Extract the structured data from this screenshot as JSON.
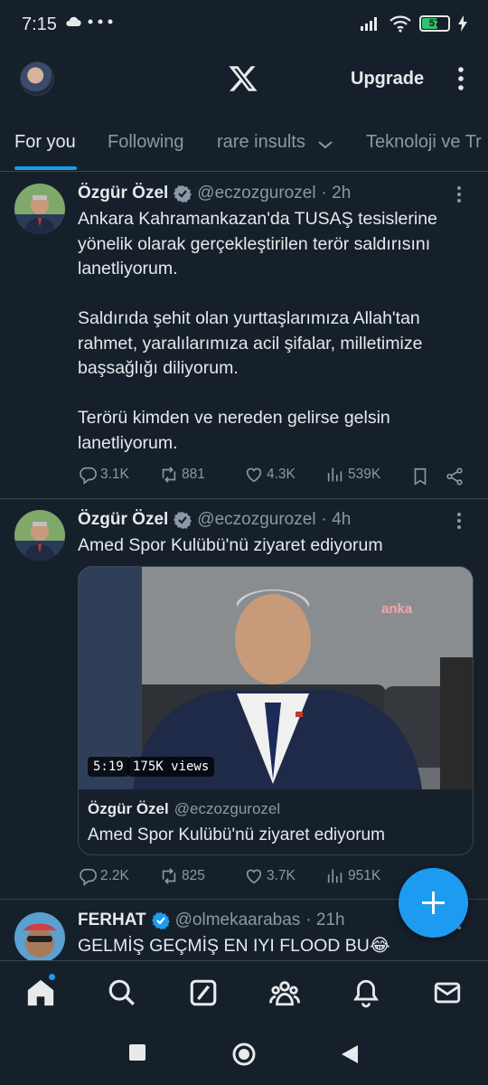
{
  "status_bar": {
    "time": "7:15",
    "battery": "57"
  },
  "top_bar": {
    "upgrade_label": "Upgrade"
  },
  "tabs": [
    {
      "label": "For you",
      "active": true
    },
    {
      "label": "Following"
    },
    {
      "label": "rare insults"
    },
    {
      "label": "Teknoloji ve Tr"
    }
  ],
  "tweets": [
    {
      "name": "Özgür Özel",
      "handle": "@eczozgurozel",
      "time": "· 2h",
      "paragraphs": [
        "Ankara Kahramankazan'da TUSAŞ tesislerine yönelik olarak gerçekleştirilen terör saldırısını lanetliyorum.",
        "Saldırıda şehit olan yurttaşlarımıza Allah'tan rahmet, yaralılarımıza acil şifalar, milletimize başsağlığı diliyorum.",
        "Terörü kimden ve nereden gelirse gelsin lanetliyorum."
      ],
      "replies": "3.1K",
      "reposts": "881",
      "likes": "4.3K",
      "views": "539K"
    },
    {
      "name": "Özgür Özel",
      "handle": "@eczozgurozel",
      "time": "· 4h",
      "text": "Amed Spor Kulübü'nü ziyaret ediyorum",
      "video": {
        "duration": "5:19",
        "views": "175K views",
        "watermark": "anka"
      },
      "quote": {
        "name": "Özgür Özel",
        "handle": "@eczozgurozel",
        "text": "Amed Spor Kulübü'nü ziyaret ediyorum"
      },
      "replies": "2.2K",
      "reposts": "825",
      "likes": "3.7K",
      "views": "951K"
    },
    {
      "name": "FERHAT",
      "handle": "@olmekaarabas",
      "time": "· 21h",
      "text": "GELMİŞ GEÇMİŞ  EN IYI FLOOD BU😂"
    }
  ],
  "colors": {
    "background": "#15202b",
    "accent": "#1d9bf0",
    "muted": "#8b98a5",
    "divider": "#38444d"
  }
}
